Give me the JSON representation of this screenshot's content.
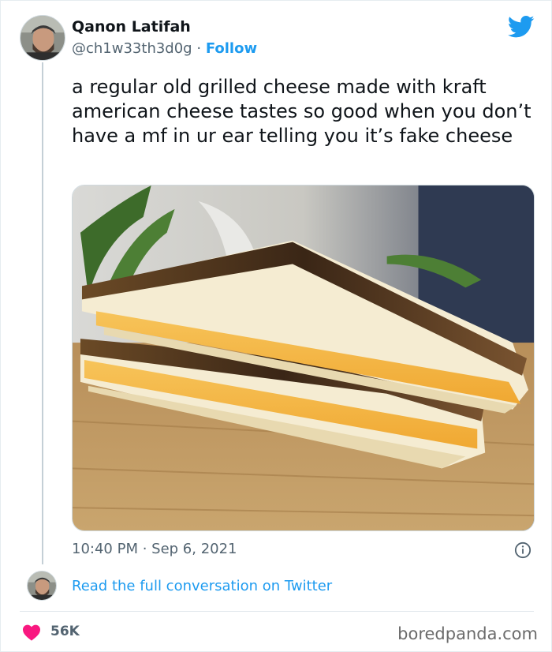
{
  "author": {
    "name": "Qanon Latifah",
    "handle": "@ch1w33th3d0g",
    "separator": "·",
    "follow_label": "Follow"
  },
  "tweet": {
    "text": "a regular old grilled cheese made with kraft american cheese tastes so good when you don’t have a mf in ur ear telling you it’s fake cheese",
    "timestamp": "10:40 PM · Sep 6, 2021",
    "media_subject": "grilled cheese sandwich photo"
  },
  "footer": {
    "read_conversation_label": "Read the full conversation on Twitter",
    "likes_count": "56K"
  },
  "watermark": "boredpanda.com",
  "icons": {
    "brand": "twitter-bird-icon",
    "info": "info-icon",
    "like": "heart-icon"
  },
  "colors": {
    "accent": "#1d9bf0",
    "like": "#f91880",
    "secondary_text": "#536471"
  }
}
